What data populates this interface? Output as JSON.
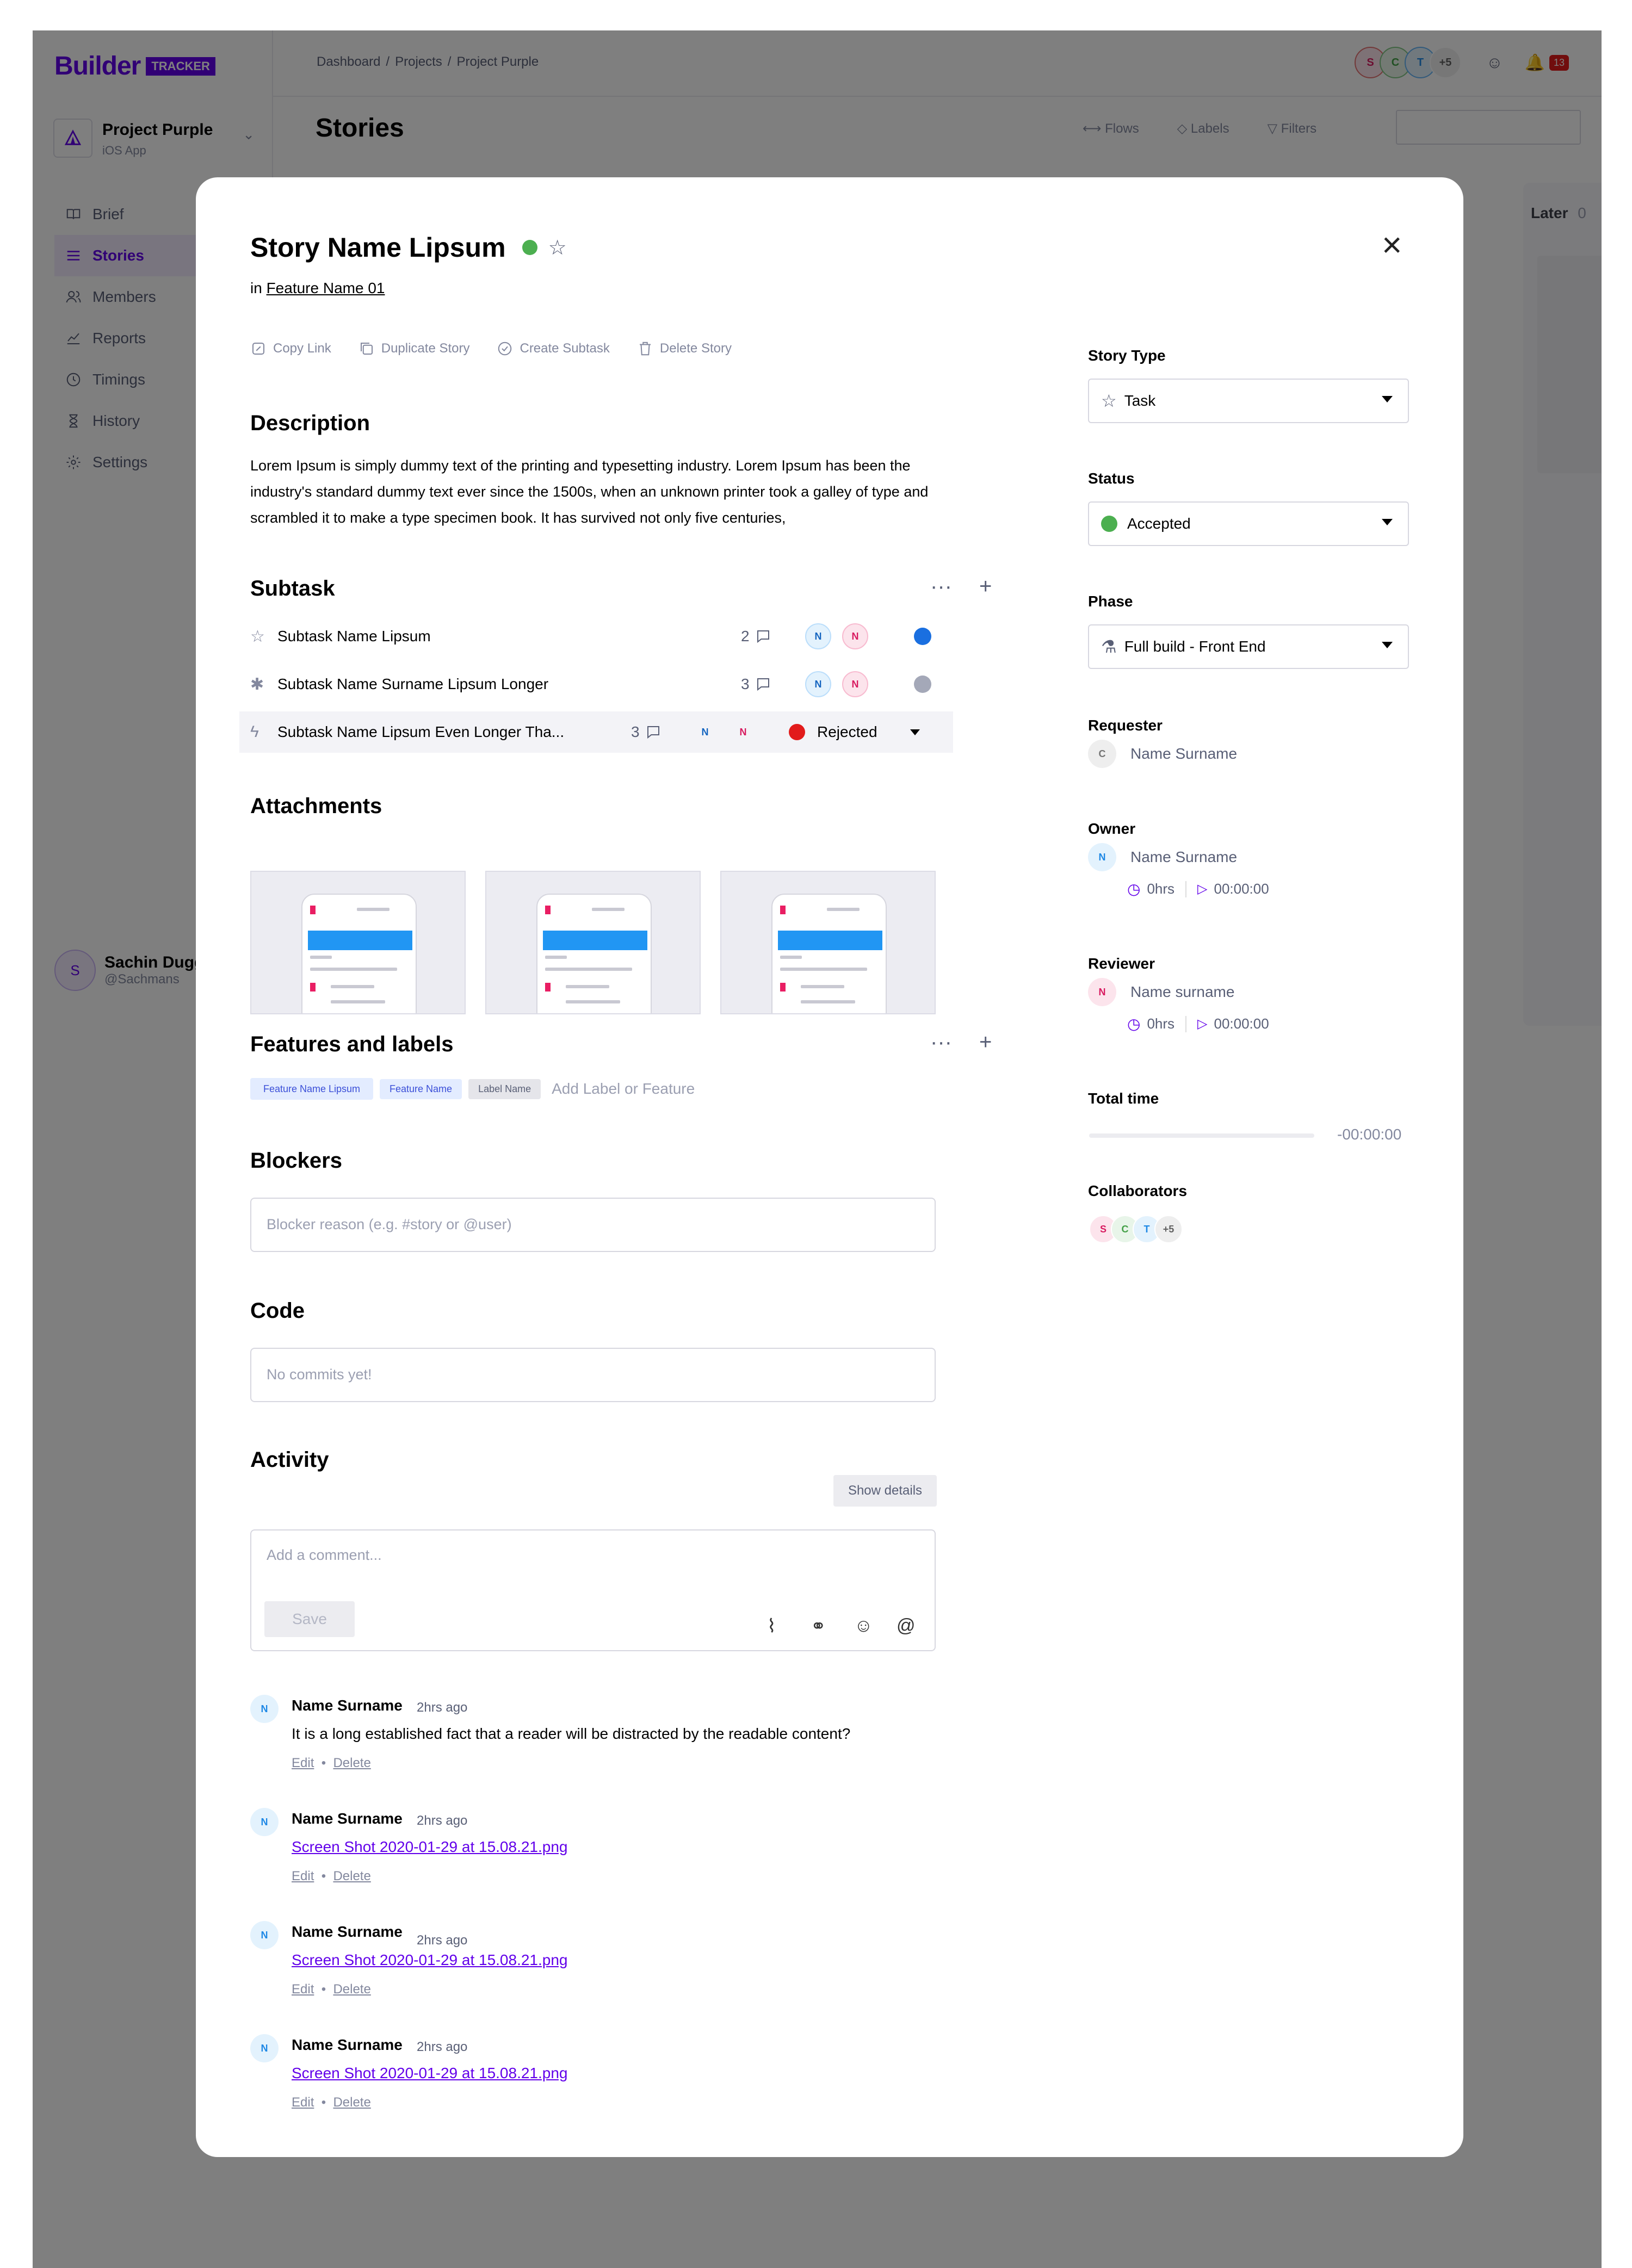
{
  "app": {
    "logo_word": "Builder",
    "logo_tag": "TRACKER",
    "project_name": "Project Purple",
    "project_sub": "iOS App"
  },
  "sidebar": {
    "items": [
      {
        "label": "Brief",
        "icon": "book-icon"
      },
      {
        "label": "Stories",
        "icon": "list-icon",
        "active": true
      },
      {
        "label": "Members",
        "icon": "members-icon"
      },
      {
        "label": "Reports",
        "icon": "chart-line-icon"
      },
      {
        "label": "Timings",
        "icon": "clock-icon"
      },
      {
        "label": "History",
        "icon": "hourglass-icon"
      },
      {
        "label": "Settings",
        "icon": "gear-icon"
      }
    ],
    "user": {
      "initial": "S",
      "name": "Sachin Dugg",
      "handle": "@Sachmans"
    }
  },
  "header": {
    "breadcrumb": [
      "Dashboard",
      "Projects",
      "Project Purple"
    ],
    "avatars": [
      "S",
      "C",
      "T",
      "+5"
    ],
    "notifications": "13",
    "page_title": "Stories",
    "tools": [
      "Flows",
      "Labels",
      "Filters"
    ],
    "later_label": "Later",
    "later_count": "0"
  },
  "modal": {
    "title": "Story Name Lipsum",
    "in_prefix": "in",
    "feature_link": "Feature Name 01",
    "actions": [
      "Copy Link",
      "Duplicate Story",
      "Create Subtask",
      "Delete Story"
    ],
    "description_heading": "Description",
    "description": "Lorem Ipsum is simply dummy text of the printing and typesetting industry. Lorem Ipsum has been the industry's standard dummy text ever since the 1500s, when an unknown printer took a galley of type and scrambled it to make a type specimen book. It has survived not only five centuries,",
    "subtask_heading": "Subtask",
    "subtasks": [
      {
        "name": "Subtask Name Lipsum",
        "comments": "2",
        "status_color": "#1a6fe0",
        "icon": "star-icon"
      },
      {
        "name": "Subtask Name  Surname Lipsum Longer",
        "comments": "3",
        "status_color": "#a4a8b8",
        "icon": "bug-icon"
      },
      {
        "name": "Subtask Name Lipsum Even Longer Tha...",
        "comments": "3",
        "status_color": "#e21b1b",
        "status_label": "Rejected",
        "icon": "bolt-icon"
      }
    ],
    "attachments_heading": "Attachments",
    "features_heading": "Features and labels",
    "chips": [
      "Feature Name Lipsum",
      "Feature Name",
      "Label Name"
    ],
    "add_label_placeholder": "Add Label or Feature",
    "blockers_heading": "Blockers",
    "blocker_placeholder": "Blocker reason (e.g. #story or @user)",
    "code_heading": "Code",
    "code_placeholder": "No commits yet!",
    "activity_heading": "Activity",
    "show_details": "Show details",
    "comment_placeholder": "Add a comment...",
    "save_label": "Save",
    "comments": [
      {
        "initial": "N",
        "name": "Name Surname",
        "time": "2hrs ago",
        "text": "It is a long established fact that a reader will be distracted by the readable content?"
      },
      {
        "initial": "N",
        "name": "Name Surname",
        "time": "2hrs ago",
        "link": "Screen Shot 2020-01-29 at 15.08.21.png"
      },
      {
        "initial": "N",
        "name": "Name Surname",
        "time": "2hrs ago",
        "link": "Screen Shot 2020-01-29 at 15.08.21.png"
      },
      {
        "initial": "N",
        "name": "Name Surname",
        "time": "2hrs ago",
        "link": "Screen Shot 2020-01-29 at 15.08.21.png"
      }
    ],
    "edit_label": "Edit",
    "delete_label": "Delete",
    "sidebar": {
      "story_type_label": "Story Type",
      "story_type_value": "Task",
      "status_label": "Status",
      "status_value": "Accepted",
      "status_color": "#4caf50",
      "phase_label": "Phase",
      "phase_value": "Full build - Front End",
      "requester_label": "Requester",
      "requester": {
        "initial": "C",
        "name": "Name Surname"
      },
      "owner_label": "Owner",
      "owner": {
        "initial": "N",
        "name": "Name Surname",
        "hours": "0hrs",
        "timer": "00:00:00"
      },
      "reviewer_label": "Reviewer",
      "reviewer": {
        "initial": "N",
        "name": "Name surname",
        "hours": "0hrs",
        "timer": "00:00:00"
      },
      "total_time_label": "Total time",
      "total_time": "-00:00:00",
      "collaborators_label": "Collaborators",
      "collaborators": [
        "S",
        "C",
        "T",
        "+5"
      ]
    }
  },
  "colors": {
    "brand": "#6200ea",
    "accepted": "#4caf50",
    "rejected": "#e21b1b"
  }
}
